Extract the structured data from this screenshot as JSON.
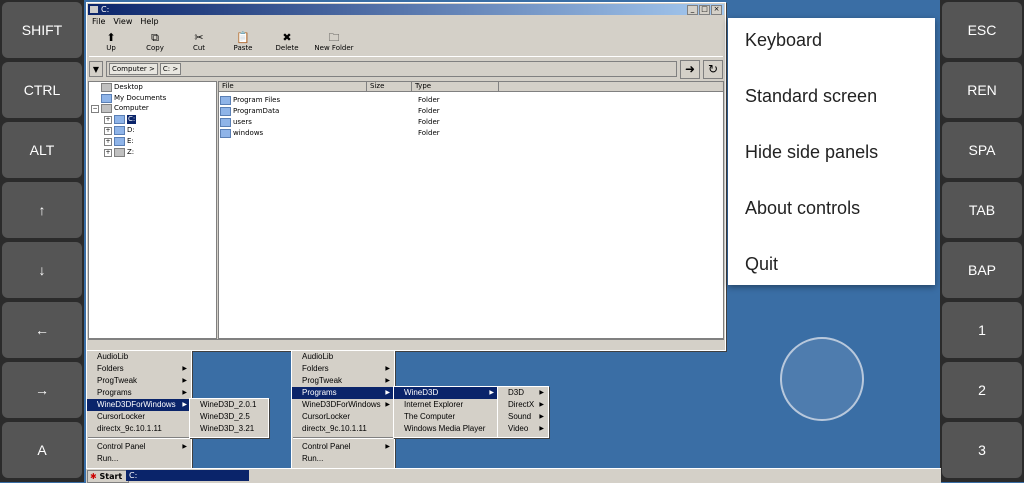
{
  "left_keys": [
    "SHIFT",
    "CTRL",
    "ALT",
    "↑",
    "↓",
    "←",
    "→",
    "A"
  ],
  "right_keys": [
    "ESC",
    "REN",
    "SPA",
    "TAB",
    "BAP",
    "1",
    "2",
    "3"
  ],
  "window": {
    "title": "C:",
    "menu": [
      "File",
      "View",
      "Help"
    ],
    "toolbar": [
      {
        "icon": "up-arrow-icon",
        "glyph": "⬆",
        "label": "Up"
      },
      {
        "icon": "copy-icon",
        "glyph": "⧉",
        "label": "Copy"
      },
      {
        "icon": "cut-icon",
        "glyph": "✂",
        "label": "Cut"
      },
      {
        "icon": "paste-icon",
        "glyph": "📋",
        "label": "Paste"
      },
      {
        "icon": "delete-icon",
        "glyph": "✖",
        "label": "Delete"
      },
      {
        "icon": "new-folder-icon",
        "glyph": "🗀",
        "label": "New Folder"
      }
    ],
    "address": {
      "crumbs": [
        "Computer >",
        "C: >"
      ]
    },
    "tree": {
      "desktop": "Desktop",
      "my_documents": "My Documents",
      "computer": "Computer",
      "drives": [
        "C:",
        "D:",
        "E:",
        "Z:"
      ]
    },
    "columns": [
      "File",
      "Size",
      "Type"
    ],
    "files": [
      {
        "name": "Program Files",
        "type": "Folder"
      },
      {
        "name": "ProgramData",
        "type": "Folder"
      },
      {
        "name": "users",
        "type": "Folder"
      },
      {
        "name": "windows",
        "type": "Folder"
      }
    ]
  },
  "menu_left": {
    "items": [
      "AudioLib",
      "Folders",
      "ProgTweak",
      "Programs",
      "WineD3DForWindows",
      "CursorLocker",
      "directx_9c.10.1.11"
    ],
    "bottom": [
      "Control Panel",
      "Run..."
    ],
    "sub": [
      "WineD3D_2.0.1",
      "WineD3D_2.5",
      "WineD3D_3.21"
    ]
  },
  "menu_right": {
    "items": [
      "AudioLib",
      "Folders",
      "ProgTweak",
      "Programs",
      "WineD3DForWindows",
      "CursorLocker",
      "directx_9c.10.1.11"
    ],
    "bottom": [
      "Control Panel",
      "Run..."
    ],
    "sub1": [
      "WineD3D",
      "Internet Explorer",
      "The Computer",
      "Windows Media Player"
    ],
    "sub2": [
      "D3D",
      "DirectX",
      "Sound",
      "Video"
    ]
  },
  "taskbar": {
    "start": "Start",
    "task": "C:"
  },
  "popup": [
    "Keyboard",
    "Standard screen",
    "Hide side panels",
    "About controls",
    "Quit"
  ]
}
